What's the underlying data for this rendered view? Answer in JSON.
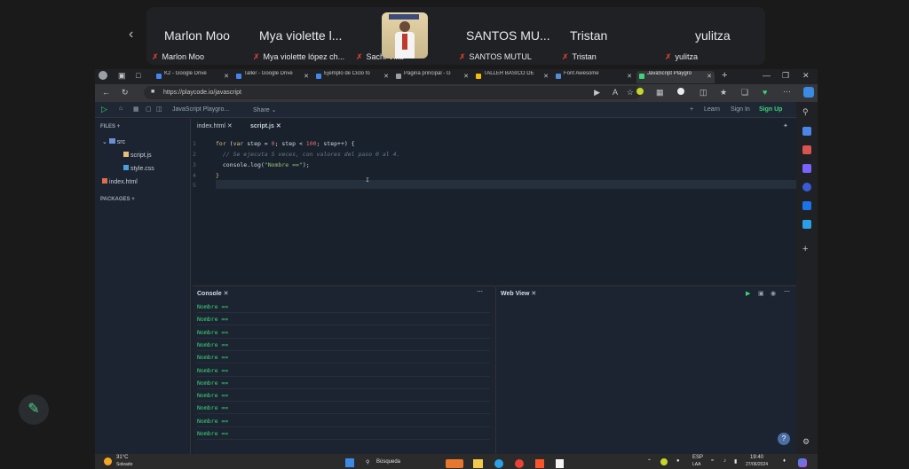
{
  "meet": {
    "participants": [
      {
        "name": "Marlon Moo",
        "sub": "Marlon Moo"
      },
      {
        "name": "Mya violette l...",
        "sub": "Mya violette lópez ch..."
      },
      {
        "name": "",
        "sub": "Sachi Villa"
      },
      {
        "name": "SANTOS MU...",
        "sub": "SANTOS MUTUL"
      },
      {
        "name": "Tristan",
        "sub": "Tristan"
      },
      {
        "name": "yulitza",
        "sub": "yulitza"
      }
    ],
    "prev_icon": "chevron-left-icon",
    "mic_off_icon": "mic-off-icon"
  },
  "browser": {
    "tabs": [
      {
        "label": "K2 - Google Drive",
        "active": false,
        "color": "#4285f4"
      },
      {
        "label": "Taller - Google Drive",
        "active": false,
        "color": "#4285f4"
      },
      {
        "label": "Ejemplo de Ciclo fo",
        "active": false,
        "color": "#4285f4"
      },
      {
        "label": "Página principal - G",
        "active": false,
        "color": "#9aa0a6"
      },
      {
        "label": "TALLER BÁSICO DE",
        "active": false,
        "color": "#fbbc04"
      },
      {
        "label": "Font Awesome",
        "active": false,
        "color": "#528dd7"
      },
      {
        "label": "JavaScript Playgro",
        "active": true,
        "color": "#3dd47a"
      }
    ],
    "url": "https://playcode.io/javascript"
  },
  "playcode": {
    "project_name": "JavaScript Playgro...",
    "share_label": "Share",
    "learn_label": "Learn",
    "signin_label": "Sign In",
    "signup_label": "Sign Up",
    "files_header": "FILES",
    "packages_header": "PACKAGES",
    "tree": [
      {
        "label": "src",
        "kind": "folder"
      },
      {
        "label": "script.js",
        "kind": "js"
      },
      {
        "label": "style.css",
        "kind": "css"
      },
      {
        "label": "index.html",
        "kind": "html"
      }
    ],
    "editor_tabs": [
      {
        "label": "index.html",
        "active": false
      },
      {
        "label": "script.js",
        "active": true
      }
    ],
    "line_numbers": [
      "1",
      "2",
      "3",
      "4",
      "5"
    ],
    "code": {
      "l1_for": "for",
      "l1_var": "var",
      "l1_a": " step = ",
      "l1_zero": "0",
      "l1_b": "; step < ",
      "l1_hundred": "100",
      "l1_c": "; step++) {",
      "l2": "  // Se ejecuta 5 veces, con valores del paso 0 al 4.",
      "l3_a": "  console.log(",
      "l3_str": "\"Nombre ==\"",
      "l3_b": ");",
      "l4": "}"
    },
    "console_title": "Console",
    "webview_title": "Web View",
    "console_lines": [
      "Nombre ==",
      "Nombre ==",
      "Nombre ==",
      "Nombre ==",
      "Nombre ==",
      "Nombre ==",
      "Nombre ==",
      "Nombre ==",
      "Nombre ==",
      "Nombre ==",
      "Nombre =="
    ]
  },
  "taskbar": {
    "weather_temp": "31°C",
    "weather_desc": "Soleado",
    "search_label": "Búsqueda",
    "lang": "ESP",
    "lang_sub": "LAA",
    "time": "19:40",
    "date": "27/06/2024"
  },
  "colors": {
    "accent_green": "#3dd47a",
    "mic_red": "#ea4335"
  }
}
